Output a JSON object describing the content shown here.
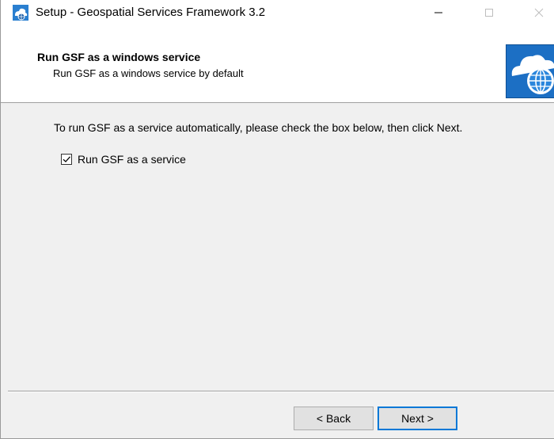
{
  "window": {
    "title": "Setup - Geospatial Services Framework 3.2",
    "controls": [
      "minimize-icon",
      "maximize-icon",
      "close-icon"
    ]
  },
  "header": {
    "title": "Run GSF as a windows service",
    "subtitle": "Run GSF as a windows service by default",
    "logo_icon": "cloud-globe-icon"
  },
  "body": {
    "instruction": "To run GSF as a service automatically, please check the box below, then click Next.",
    "checkbox": {
      "label": "Run GSF as a service",
      "checked": true
    }
  },
  "footer": {
    "back_label": "< Back",
    "next_label": "Next >"
  },
  "colors": {
    "accent": "#0078d7",
    "logo_blue": "#1c6fc4",
    "dialog_bg": "#f0f0f0"
  }
}
